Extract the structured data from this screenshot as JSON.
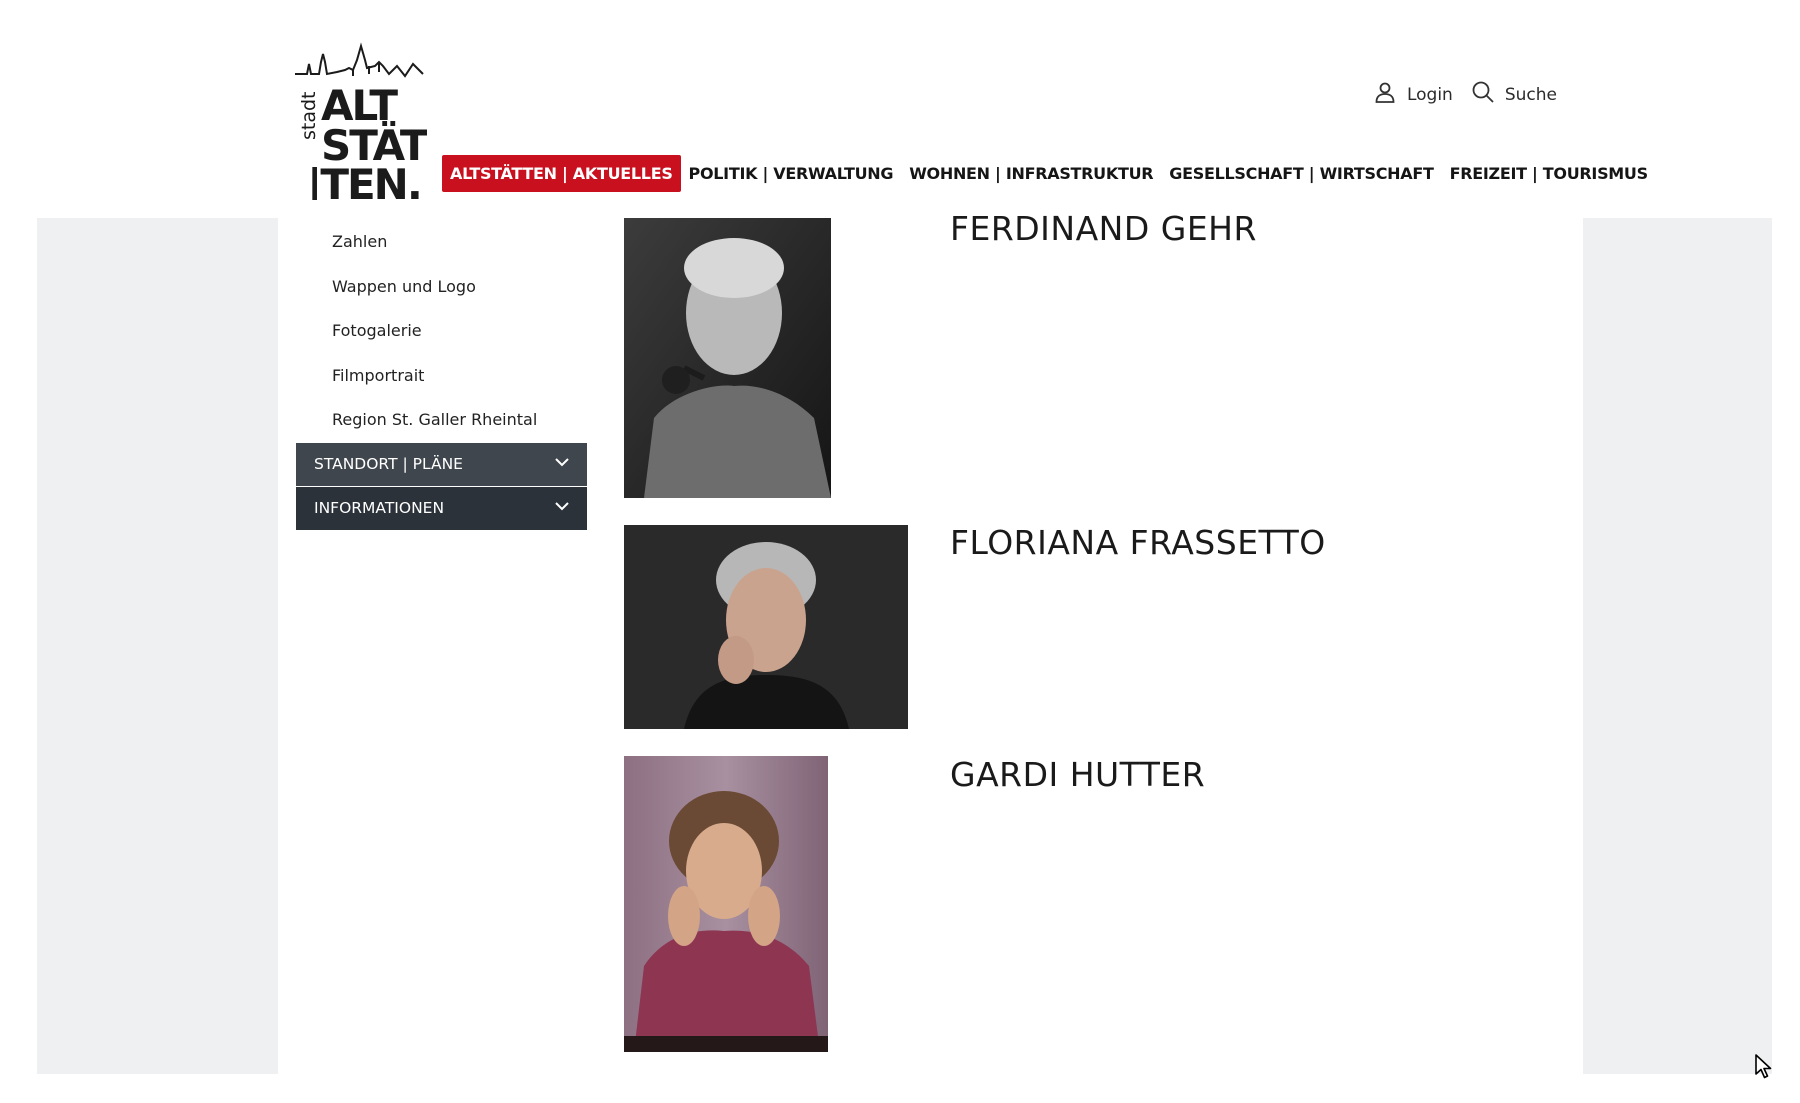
{
  "header": {
    "logo_alt": "stadt ALTSTÄTTEN.",
    "utility": {
      "login_label": "Login",
      "search_label": "Suche"
    }
  },
  "main_nav": [
    {
      "label": "ALTSTÄTTEN | AKTUELLES",
      "active": true
    },
    {
      "label": "POLITIK | VERWALTUNG",
      "active": false
    },
    {
      "label": "WOHNEN | INFRASTRUKTUR",
      "active": false
    },
    {
      "label": "GESELLSCHAFT | WIRTSCHAFT",
      "active": false
    },
    {
      "label": "FREIZEIT | TOURISMUS",
      "active": false
    }
  ],
  "sidebar": {
    "links": [
      "Zahlen",
      "Wappen und Logo",
      "Fotogalerie",
      "Filmportrait",
      "Region St. Galler Rheintal"
    ],
    "accordions": [
      {
        "label": "STANDORT | PLÄNE"
      },
      {
        "label": "INFORMATIONEN"
      }
    ]
  },
  "people": [
    {
      "name": "FERDINAND GEHR"
    },
    {
      "name": "FLORIANA FRASSETTO"
    },
    {
      "name": "GARDI HUTTER"
    }
  ],
  "colors": {
    "accent_red": "#c8101f",
    "accordion_dark": "#2b323a",
    "accordion_mid": "#40464d",
    "side_background": "#eef0f1"
  }
}
